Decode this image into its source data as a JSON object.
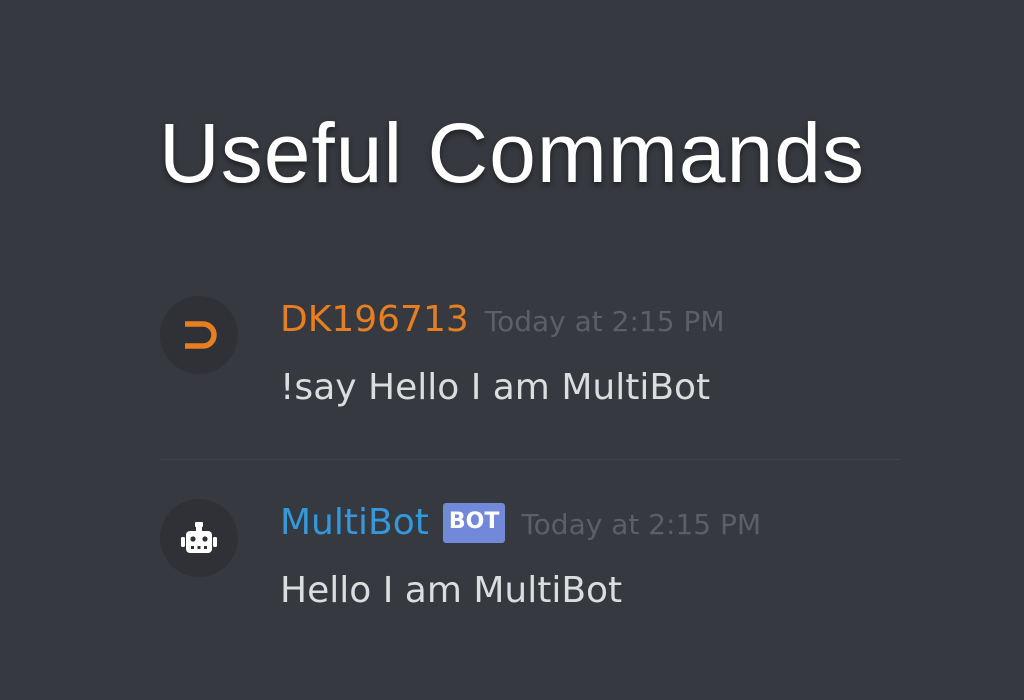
{
  "title": "Useful Commands",
  "colors": {
    "background": "#36393f",
    "user_color": "#e67e22",
    "bot_color": "#3498db",
    "bot_tag": "#7289da",
    "timestamp": "#5c5f66",
    "message_text": "#dcddde"
  },
  "messages": [
    {
      "avatar_icon": "dk-logo-icon",
      "username": "DK196713",
      "timestamp": "Today at 2:15 PM",
      "text": "!say Hello I am MultiBot"
    },
    {
      "avatar_icon": "robot-icon",
      "username": "MultiBot",
      "tag": "BOT",
      "timestamp": "Today at 2:15 PM",
      "text": "Hello I am MultiBot"
    }
  ]
}
